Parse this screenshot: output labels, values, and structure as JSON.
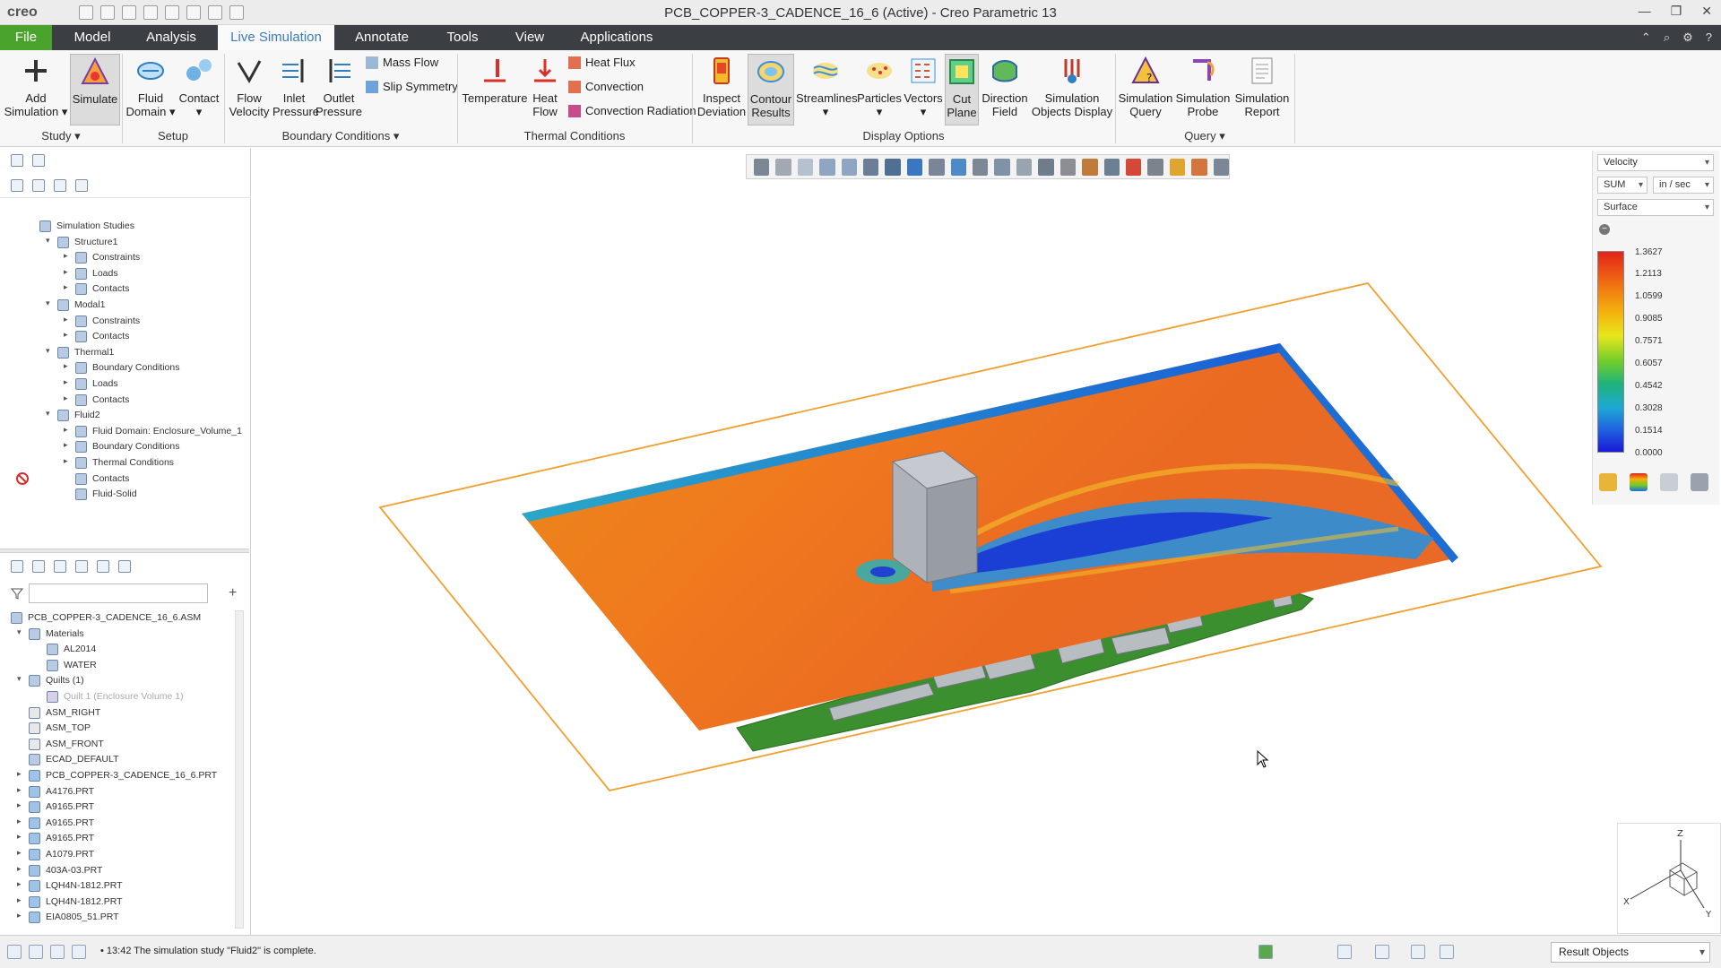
{
  "app": {
    "logo_text": "creo",
    "window_title": "PCB_COPPER-3_CADENCE_16_6 (Active) - Creo Parametric 13"
  },
  "menu": {
    "tabs": [
      "File",
      "Model",
      "Analysis",
      "Live Simulation",
      "Annotate",
      "Tools",
      "View",
      "Applications"
    ],
    "active_tab": "Live Simulation"
  },
  "ribbon": {
    "buttons": [
      {
        "line1": "Add",
        "line2": "Simulation",
        "icon": "plus-icon"
      },
      {
        "line1": "Simulate",
        "line2": "",
        "icon": "simulate-icon"
      },
      {
        "line1": "Fluid",
        "line2": "Domain",
        "icon": "fluid-domain-icon"
      },
      {
        "line1": "Contact",
        "line2": "",
        "icon": "contact-icon"
      },
      {
        "line1": "Flow",
        "line2": "Velocity",
        "icon": "flow-velocity-icon"
      },
      {
        "line1": "Inlet",
        "line2": "Pressure",
        "icon": "inlet-pressure-icon"
      },
      {
        "line1": "Outlet",
        "line2": "Pressure",
        "icon": "outlet-pressure-icon"
      },
      {
        "line1": "Temperature",
        "line2": "",
        "icon": "temperature-icon"
      },
      {
        "line1": "Heat",
        "line2": "Flow",
        "icon": "heat-flow-icon"
      },
      {
        "line1": "Inspect",
        "line2": "Deviation",
        "icon": "inspect-deviation-icon"
      },
      {
        "line1": "Contour",
        "line2": "Results",
        "icon": "contour-results-icon"
      },
      {
        "line1": "Streamlines",
        "line2": "",
        "icon": "streamlines-icon"
      },
      {
        "line1": "Particles",
        "line2": "",
        "icon": "particles-icon"
      },
      {
        "line1": "Vectors",
        "line2": "",
        "icon": "vectors-icon"
      },
      {
        "line1": "Cut",
        "line2": "Plane",
        "icon": "cut-plane-icon"
      },
      {
        "line1": "Direction",
        "line2": "Field",
        "icon": "direction-field-icon"
      },
      {
        "line1": "Simulation",
        "line2": "Objects Display",
        "icon": "simulation-objects-icon"
      },
      {
        "line1": "Simulation",
        "line2": "Query",
        "icon": "simulation-query-icon"
      },
      {
        "line1": "Simulation",
        "line2": "Probe",
        "icon": "simulation-probe-icon"
      },
      {
        "line1": "Simulation",
        "line2": "Report",
        "icon": "simulation-report-icon"
      }
    ],
    "small_buttons": [
      "Mass Flow",
      "Slip Symmetry",
      "Heat Flux",
      "Convection",
      "Convection Radiation"
    ],
    "groups": [
      "Study",
      "Setup",
      "Boundary Conditions",
      "Thermal Conditions",
      "Display Options",
      "Query"
    ]
  },
  "sim_tree": [
    {
      "label": "Simulation Studies",
      "level": 0,
      "expand": "",
      "icon": "studies-icon"
    },
    {
      "label": "Structure1",
      "level": 1,
      "expand": "▾",
      "icon": "structure-icon"
    },
    {
      "label": "Constraints",
      "level": 2,
      "expand": "▸",
      "icon": "constraints-icon"
    },
    {
      "label": "Loads",
      "level": 2,
      "expand": "▸",
      "icon": "loads-icon"
    },
    {
      "label": "Contacts",
      "level": 2,
      "expand": "▸",
      "icon": "contacts-icon"
    },
    {
      "label": "Modal1",
      "level": 1,
      "expand": "▾",
      "icon": "modal-icon"
    },
    {
      "label": "Constraints",
      "level": 2,
      "expand": "▸",
      "icon": "constraints-icon"
    },
    {
      "label": "Contacts",
      "level": 2,
      "expand": "▸",
      "icon": "contacts-icon"
    },
    {
      "label": "Thermal1",
      "level": 1,
      "expand": "▾",
      "icon": "thermal-icon"
    },
    {
      "label": "Boundary Conditions",
      "level": 2,
      "expand": "▸",
      "icon": "boundary-icon"
    },
    {
      "label": "Loads",
      "level": 2,
      "expand": "▸",
      "icon": "loads-icon"
    },
    {
      "label": "Contacts",
      "level": 2,
      "expand": "▸",
      "icon": "contacts-icon"
    },
    {
      "label": "Fluid2",
      "level": 1,
      "expand": "▾",
      "icon": "fluid-icon"
    },
    {
      "label": "Fluid Domain: Enclosure_Volume_1",
      "level": 2,
      "expand": "▸",
      "icon": "fluid-domain-icon"
    },
    {
      "label": "Boundary Conditions",
      "level": 2,
      "expand": "▸",
      "icon": "boundary-icon"
    },
    {
      "label": "Thermal Conditions",
      "level": 2,
      "expand": "▸",
      "icon": "thermal-icon"
    },
    {
      "label": "Contacts",
      "level": 2,
      "expand": "",
      "icon": "contacts-icon"
    },
    {
      "label": "Fluid-Solid",
      "level": 2,
      "expand": "",
      "icon": "fluid-solid-icon"
    }
  ],
  "model_tree": [
    {
      "label": "PCB_COPPER-3_CADENCE_16_6.ASM",
      "level": 0,
      "expand": "",
      "icon": "assembly-icon",
      "dim": false
    },
    {
      "label": "Materials",
      "level": 1,
      "expand": "▾",
      "icon": "materials-icon",
      "dim": false
    },
    {
      "label": "AL2014",
      "level": 2,
      "expand": "",
      "icon": "material-icon",
      "dim": false
    },
    {
      "label": "WATER",
      "level": 2,
      "expand": "",
      "icon": "material-icon",
      "dim": false
    },
    {
      "label": "Quilts (1)",
      "level": 1,
      "expand": "▾",
      "icon": "quilts-icon",
      "dim": false
    },
    {
      "label": "Quilt 1 (Enclosure Volume 1)",
      "level": 2,
      "expand": "",
      "icon": "quilt-icon",
      "dim": true
    },
    {
      "label": "ASM_RIGHT",
      "level": 1,
      "expand": "",
      "icon": "datum-plane-icon",
      "dim": false
    },
    {
      "label": "ASM_TOP",
      "level": 1,
      "expand": "",
      "icon": "datum-plane-icon",
      "dim": false
    },
    {
      "label": "ASM_FRONT",
      "level": 1,
      "expand": "",
      "icon": "datum-plane-icon",
      "dim": false
    },
    {
      "label": "ECAD_DEFAULT",
      "level": 1,
      "expand": "",
      "icon": "csys-icon",
      "dim": false
    },
    {
      "label": "PCB_COPPER-3_CADENCE_16_6.PRT",
      "level": 1,
      "expand": "▸",
      "icon": "pcb-part-icon",
      "dim": false
    },
    {
      "label": "A4176.PRT",
      "level": 1,
      "expand": "▸",
      "icon": "part-icon",
      "dim": false
    },
    {
      "label": "A9165.PRT",
      "level": 1,
      "expand": "▸",
      "icon": "part-icon",
      "dim": false
    },
    {
      "label": "A9165.PRT",
      "level": 1,
      "expand": "▸",
      "icon": "part-icon",
      "dim": false
    },
    {
      "label": "A9165.PRT",
      "level": 1,
      "expand": "▸",
      "icon": "part-icon",
      "dim": false
    },
    {
      "label": "A1079.PRT",
      "level": 1,
      "expand": "▸",
      "icon": "part-icon",
      "dim": false
    },
    {
      "label": "403A-03.PRT",
      "level": 1,
      "expand": "▸",
      "icon": "part-icon",
      "dim": false
    },
    {
      "label": "LQH4N-1812.PRT",
      "level": 1,
      "expand": "▸",
      "icon": "part-icon",
      "dim": false
    },
    {
      "label": "LQH4N-1812.PRT",
      "level": 1,
      "expand": "▸",
      "icon": "part-icon",
      "dim": false
    },
    {
      "label": "EIA0805_51.PRT",
      "level": 1,
      "expand": "▸",
      "icon": "part-icon",
      "dim": false
    }
  ],
  "legend": {
    "quantity": "Velocity",
    "mode": "SUM",
    "units": "in / sec",
    "display": "Surface",
    "values": [
      "1.3627",
      "1.2113",
      "1.0599",
      "0.9085",
      "0.7571",
      "0.6057",
      "0.4542",
      "0.3028",
      "0.1514",
      "0.0000"
    ]
  },
  "status": {
    "message": "13:42 The simulation study \"Fluid2\" is complete.",
    "filter_value": "Result Objects"
  },
  "colors": {
    "file_tab": "#4aa32d",
    "menubar": "#3b3e43",
    "active_tab_text": "#3a7bc0",
    "plane_outline": "#f0a030",
    "pcb_green": "#3c8f2f"
  }
}
